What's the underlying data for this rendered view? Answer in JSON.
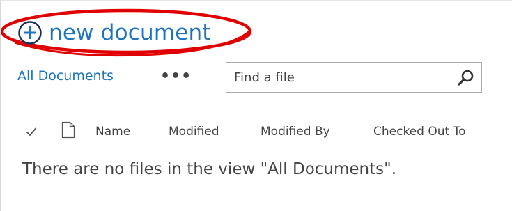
{
  "toolbar": {
    "new_document_label": "new document"
  },
  "view": {
    "name": "All Documents",
    "more_label": "•••"
  },
  "search": {
    "placeholder": "Find a file",
    "value": ""
  },
  "columns": {
    "select_icon": "checkmark-icon",
    "type_icon": "document-icon",
    "headers": [
      "Name",
      "Modified",
      "Modified By",
      "Checked Out To"
    ]
  },
  "list": {
    "empty_message": "There are no files in the view \"All Documents\"."
  },
  "colors": {
    "accent": "#1e73be",
    "text": "#444444",
    "annotation": "#e00000"
  }
}
